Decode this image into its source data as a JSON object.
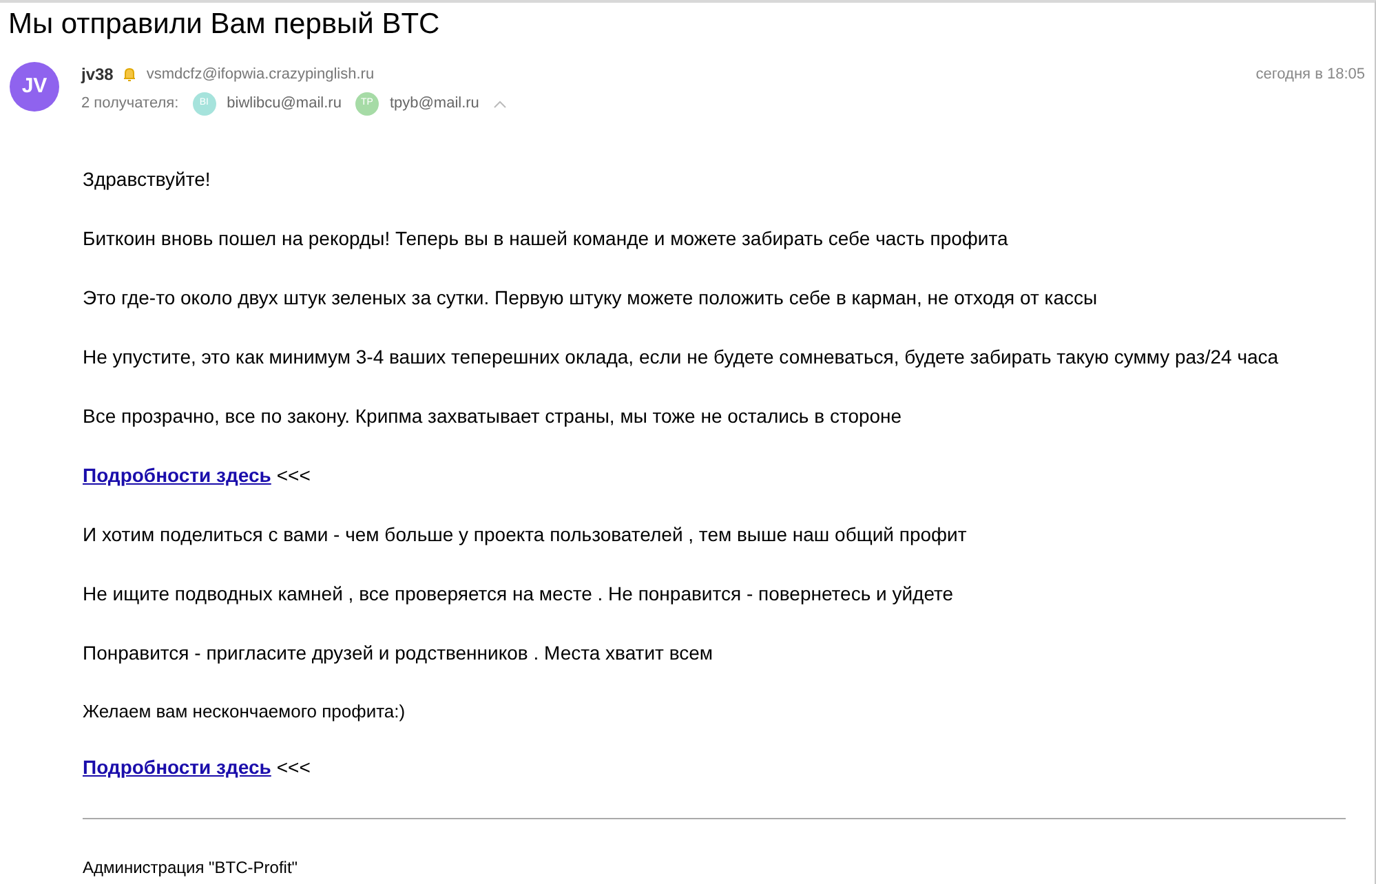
{
  "subject": "Мы отправили Вам первый BTC",
  "sender": {
    "avatar": "JV",
    "name": "jv38",
    "email": "vsmdcfz@ifopwia.crazypinglish.ru",
    "date": "сегодня в 18:05"
  },
  "recipients": {
    "label": "2 получателя:",
    "items": [
      {
        "avatar": "BI",
        "email": "biwlibcu@mail.ru",
        "color": "#a6e3dc"
      },
      {
        "avatar": "TP",
        "email": "tpyb@mail.ru",
        "color": "#a6dba6"
      }
    ]
  },
  "body": [
    {
      "kind": "text",
      "text": "Здравствуйте!"
    },
    {
      "kind": "text",
      "text": "Биткоин вновь пошел на рекорды! Теперь вы в нашей команде и можете забирать себе часть профита"
    },
    {
      "kind": "text",
      "text": "Это где-то около двух штук зеленых за сутки. Первую штуку можете положить себе в карман, не отходя от кассы"
    },
    {
      "kind": "text",
      "text": "Не упустите, это как минимум 3-4 ваших теперешних оклада, если не будете сомневаться, будете забирать такую сумму раз/24 часа"
    },
    {
      "kind": "text",
      "text": "Все прозрачно, все по закону. Крипма захватывает страны, мы тоже не остались в стороне"
    },
    {
      "kind": "link",
      "link": "Подробности здесь",
      "text": "<<<"
    },
    {
      "kind": "text",
      "text": "И хотим поделиться с вами - чем больше у проекта пользователей , тем выше наш общий профит"
    },
    {
      "kind": "text",
      "text": "Не ищите подводных камней , все проверяется на месте . Не понравится - повернетесь и уйдете"
    },
    {
      "kind": "text",
      "text": "Понравится - пригласите друзей и родственников . Места хватит всем"
    },
    {
      "kind": "small",
      "text": "Желаем вам нескончаемого профита:)"
    },
    {
      "kind": "link",
      "link": "Подробности здесь",
      "text": "<<<"
    }
  ],
  "signature": "Администрация \"BTC-Profit\""
}
